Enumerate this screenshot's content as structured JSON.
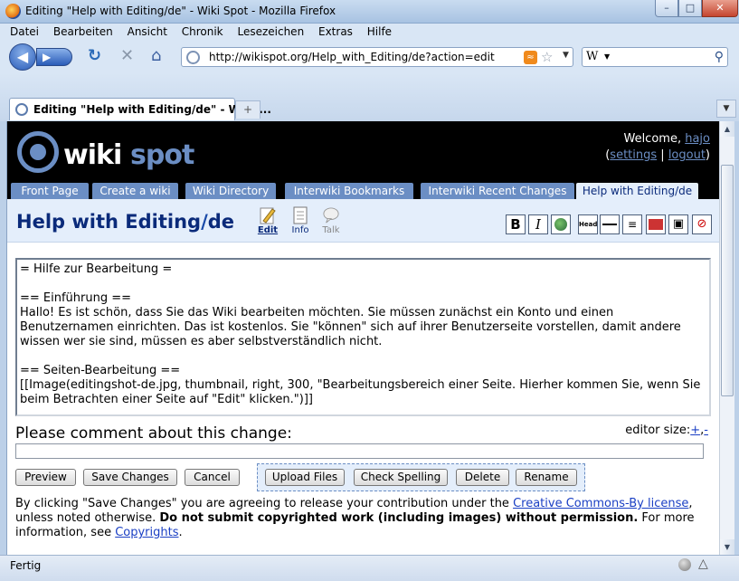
{
  "window": {
    "title": "Editing \"Help with Editing/de\" - Wiki Spot - Mozilla Firefox"
  },
  "menu": [
    "Datei",
    "Bearbeiten",
    "Ansicht",
    "Chronik",
    "Lesezeichen",
    "Extras",
    "Hilfe"
  ],
  "nav": {
    "url": "http://wikispot.org/Help_with_Editing/de?action=edit",
    "search_engine": "W",
    "search_value": ""
  },
  "browser_tab": {
    "title": "Editing \"Help with Editing/de\" - Wiki ..."
  },
  "site": {
    "logo_wiki": "wiki",
    "logo_spot": "spot",
    "welcome_prefix": "Welcome, ",
    "user": "hajo",
    "settings": "settings",
    "logout": "logout",
    "separator": "|",
    "open_paren": "(",
    "close_paren": ")"
  },
  "site_tabs": [
    "Front Page",
    "Create a wiki",
    "Wiki Directory",
    "Interwiki Bookmarks",
    "Interwiki Recent Changes",
    "Help with Editing/de"
  ],
  "page": {
    "title_main": "Help with Editing",
    "title_slash": "/",
    "title_sub": "de",
    "actions": {
      "edit": "Edit",
      "info": "Info",
      "talk": "Talk"
    }
  },
  "toolbar": {
    "bold": "B",
    "italic": "I",
    "heading": "Head"
  },
  "editor": {
    "text": "= Hilfe zur Bearbeitung =\n\n== Einführung ==\nHallo! Es ist schön, dass Sie das Wiki bearbeiten möchten. Sie müssen zunächst ein Konto und einen Benutzernamen einrichten. Das ist kostenlos. Sie \"können\" sich auf ihrer Benutzerseite vorstellen, damit andere wissen wer sie sind, müssen es aber selbstverständlich nicht.\n\n== Seiten-Bearbeitung ==\n[[Image(editingshot-de.jpg, thumbnail, right, 300, \"Bearbeitungsbereich einer Seite. Hierher kommen Sie, wenn Sie beim Betrachten einer Seite auf \"Edit\" klicken.\")]]"
  },
  "comment": {
    "label": "Please comment about this change:",
    "value": ""
  },
  "editor_size": {
    "label": "editor size:",
    "plus": "+",
    "comma": ",",
    "minus": "-"
  },
  "buttons": {
    "preview": "Preview",
    "save": "Save Changes",
    "cancel": "Cancel",
    "upload": "Upload Files",
    "spell": "Check Spelling",
    "delete": "Delete",
    "rename": "Rename"
  },
  "notice": {
    "part1": "By clicking \"Save Changes\" you are agreeing to release your contribution under the ",
    "license_link": "Creative Commons-By license",
    "part2": ", unless noted otherwise. ",
    "bold": "Do not submit copyrighted work (including images) without permission.",
    "part3": " For more information, see ",
    "copyrights_link": "Copyrights",
    "part4": "."
  },
  "status": {
    "text": "Fertig"
  }
}
